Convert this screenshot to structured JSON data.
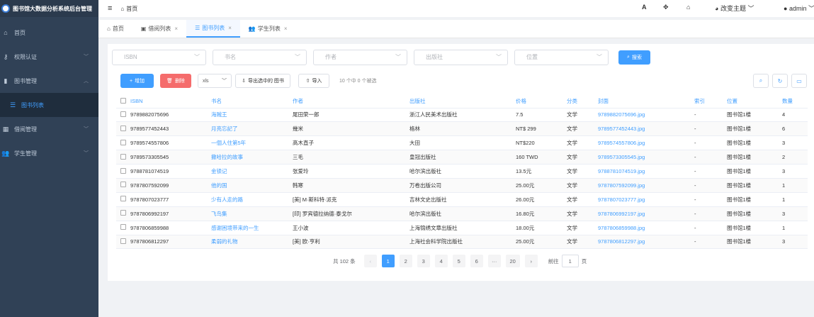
{
  "app": {
    "title": "图书馆大数据分析系统后台管理"
  },
  "sidebar": {
    "items": [
      {
        "label": "首页",
        "icon": "home-icon"
      },
      {
        "label": "权限认证",
        "icon": "key-icon"
      },
      {
        "label": "图书管理",
        "icon": "book-icon"
      },
      {
        "label": "图书列表",
        "icon": "list-icon"
      },
      {
        "label": "借阅管理",
        "icon": "grid-icon"
      },
      {
        "label": "学生管理",
        "icon": "users-icon"
      }
    ]
  },
  "topbar": {
    "breadcrumb": "首页",
    "font_icon_label": "A",
    "theme_label": "改变主题",
    "user_label": "admin"
  },
  "tabs": [
    {
      "label": "首页"
    },
    {
      "label": "借阅列表"
    },
    {
      "label": "图书列表"
    },
    {
      "label": "学生列表"
    }
  ],
  "filters": {
    "isbn": "ISBN",
    "title": "书名",
    "author": "作者",
    "publisher": "出版社",
    "location": "位置",
    "search_label": "搜索"
  },
  "toolbar": {
    "add_label": "增加",
    "delete_label": "删除",
    "format_value": "xls",
    "export_label": "导出选中的 图书",
    "import_label": "导入",
    "selection_text": "10 个中 0 个被选"
  },
  "table": {
    "headers": [
      "ISBN",
      "书名",
      "作者",
      "出版社",
      "价格",
      "分类",
      "封面",
      "索引",
      "位置",
      "数量"
    ],
    "rows": [
      [
        "9789882075696",
        "海贼王",
        "尾田荣一郎",
        "浙江人民美术出版社",
        "7.5",
        "文学",
        "9789882075696.jpg",
        "-",
        "图书馆1楼",
        "4"
      ],
      [
        "9789577452443",
        "月亮忘記了",
        "幾米",
        "格林",
        "NT$ 299",
        "文学",
        "9789577452443.jpg",
        "-",
        "图书馆1楼",
        "6"
      ],
      [
        "9789574557806",
        "一個人住第5年",
        "高木直子",
        "大田",
        "NT$220",
        "文学",
        "9789574557806.jpg",
        "-",
        "图书馆1楼",
        "3"
      ],
      [
        "9789573305545",
        "撒哈拉的故事",
        "三毛",
        "皇冠出版社",
        "160 TWD",
        "文学",
        "9789573305545.jpg",
        "-",
        "图书馆1楼",
        "2"
      ],
      [
        "9788781074519",
        "金锁记",
        "张爱玲",
        "哈尔滨出版社",
        "13.5元",
        "文学",
        "9788781074519.jpg",
        "-",
        "图书馆1楼",
        "3"
      ],
      [
        "9787807592099",
        "他的国",
        "韩寒",
        "万卷出版公司",
        "25.00元",
        "文学",
        "9787807592099.jpg",
        "-",
        "图书馆1楼",
        "1"
      ],
      [
        "9787807023777",
        "少有人走的路",
        "[美] M·斯科特·派克",
        "吉林文史出版社",
        "26.00元",
        "文学",
        "9787807023777.jpg",
        "-",
        "图书馆1楼",
        "1"
      ],
      [
        "9787806992197",
        "飞鸟集",
        "[印] 罗宾德拉纳德·泰戈尔",
        "哈尔滨出版社",
        "16.80元",
        "文学",
        "9787806992197.jpg",
        "-",
        "图书馆1楼",
        "3"
      ],
      [
        "9787806859988",
        "感谢困境带来的一生",
        "王小波",
        "上海锦绣文章出版社",
        "18.00元",
        "文学",
        "9787806859988.jpg",
        "-",
        "图书馆1楼",
        "1"
      ],
      [
        "9787806812297",
        "柔弱的礼物",
        "[美] 欧·亨利",
        "上海社会科学院出版社",
        "25.00元",
        "文学",
        "9787806812297.jpg",
        "-",
        "图书馆1楼",
        "3"
      ]
    ]
  },
  "pagination": {
    "total_text": "共 102 条",
    "pages": [
      "1",
      "2",
      "3",
      "4",
      "5",
      "6",
      "···",
      "20"
    ],
    "current": "1",
    "goto_label": "前往",
    "goto_value": "1",
    "page_suffix": "页"
  },
  "colors": {
    "sidebar_bg": "#304156",
    "primary": "#409eff",
    "danger": "#f56c6c"
  }
}
